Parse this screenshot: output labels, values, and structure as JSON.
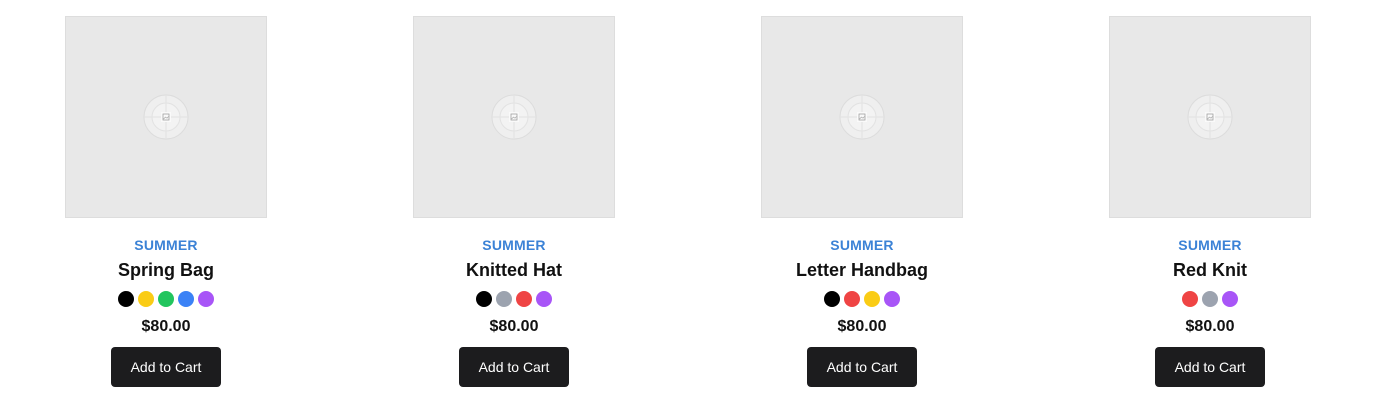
{
  "products": [
    {
      "category": "SUMMER",
      "name": "Spring Bag",
      "price": "$80.00",
      "button_label": "Add to Cart",
      "colors": [
        "#000000",
        "#facc15",
        "#22c55e",
        "#3b82f6",
        "#a855f7"
      ]
    },
    {
      "category": "SUMMER",
      "name": "Knitted Hat",
      "price": "$80.00",
      "button_label": "Add to Cart",
      "colors": [
        "#000000",
        "#9ca3af",
        "#ef4444",
        "#a855f7"
      ]
    },
    {
      "category": "SUMMER",
      "name": "Letter Handbag",
      "price": "$80.00",
      "button_label": "Add to Cart",
      "colors": [
        "#000000",
        "#ef4444",
        "#facc15",
        "#a855f7"
      ]
    },
    {
      "category": "SUMMER",
      "name": "Red Knit",
      "price": "$80.00",
      "button_label": "Add to Cart",
      "colors": [
        "#ef4444",
        "#9ca3af",
        "#a855f7"
      ]
    }
  ],
  "image_placeholder_icon": "image-placeholder-icon"
}
